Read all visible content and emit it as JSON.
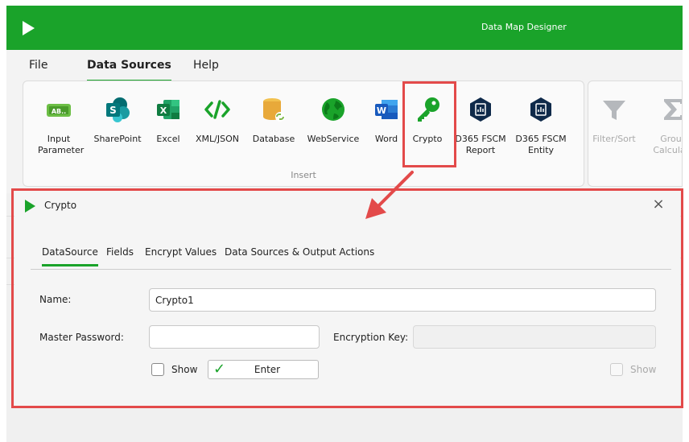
{
  "app": {
    "title": "Data Map Designer"
  },
  "menu": {
    "items": [
      "File",
      "Data Sources",
      "Help"
    ],
    "active": "Data Sources"
  },
  "ribbon": {
    "insert_group_label": "Insert",
    "buttons": [
      {
        "label_line1": "Input",
        "label_line2": "Parameter",
        "icon": "input-parameter-icon"
      },
      {
        "label_line1": "SharePoint",
        "label_line2": "",
        "icon": "sharepoint-icon"
      },
      {
        "label_line1": "Excel",
        "label_line2": "",
        "icon": "excel-icon"
      },
      {
        "label_line1": "XML/JSON",
        "label_line2": "",
        "icon": "xml-json-icon"
      },
      {
        "label_line1": "Database",
        "label_line2": "",
        "icon": "database-icon"
      },
      {
        "label_line1": "WebService",
        "label_line2": "",
        "icon": "webservice-icon"
      },
      {
        "label_line1": "Word",
        "label_line2": "",
        "icon": "word-icon"
      },
      {
        "label_line1": "Crypto",
        "label_line2": "",
        "icon": "crypto-key-icon"
      },
      {
        "label_line1": "D365 FSCM",
        "label_line2": "Report",
        "icon": "d365-report-icon"
      },
      {
        "label_line1": "D365 FSCM",
        "label_line2": "Entity",
        "icon": "d365-entity-icon"
      }
    ],
    "second_group": [
      {
        "label_line1": "Filter/Sort",
        "label_line2": "",
        "icon": "filter-icon",
        "disabled": true
      },
      {
        "label_line1": "Group",
        "label_line2": "Calculato",
        "icon": "sigma-icon",
        "disabled": true
      }
    ]
  },
  "dialog": {
    "title": "Crypto",
    "close_label": "×",
    "tabs": [
      "DataSource",
      "Fields",
      "Encrypt Values",
      "Data Sources & Output Actions"
    ],
    "active_tab": "DataSource",
    "name_label": "Name:",
    "name_value": "Crypto1",
    "master_password_label": "Master Password:",
    "master_password_value": "",
    "encryption_key_label": "Encryption Key:",
    "encryption_key_value": "",
    "show_label": "Show",
    "enter_label": "Enter",
    "show_right_label": "Show"
  },
  "colors": {
    "brand_green": "#1aa32a",
    "highlight_red": "#e34a4a"
  }
}
